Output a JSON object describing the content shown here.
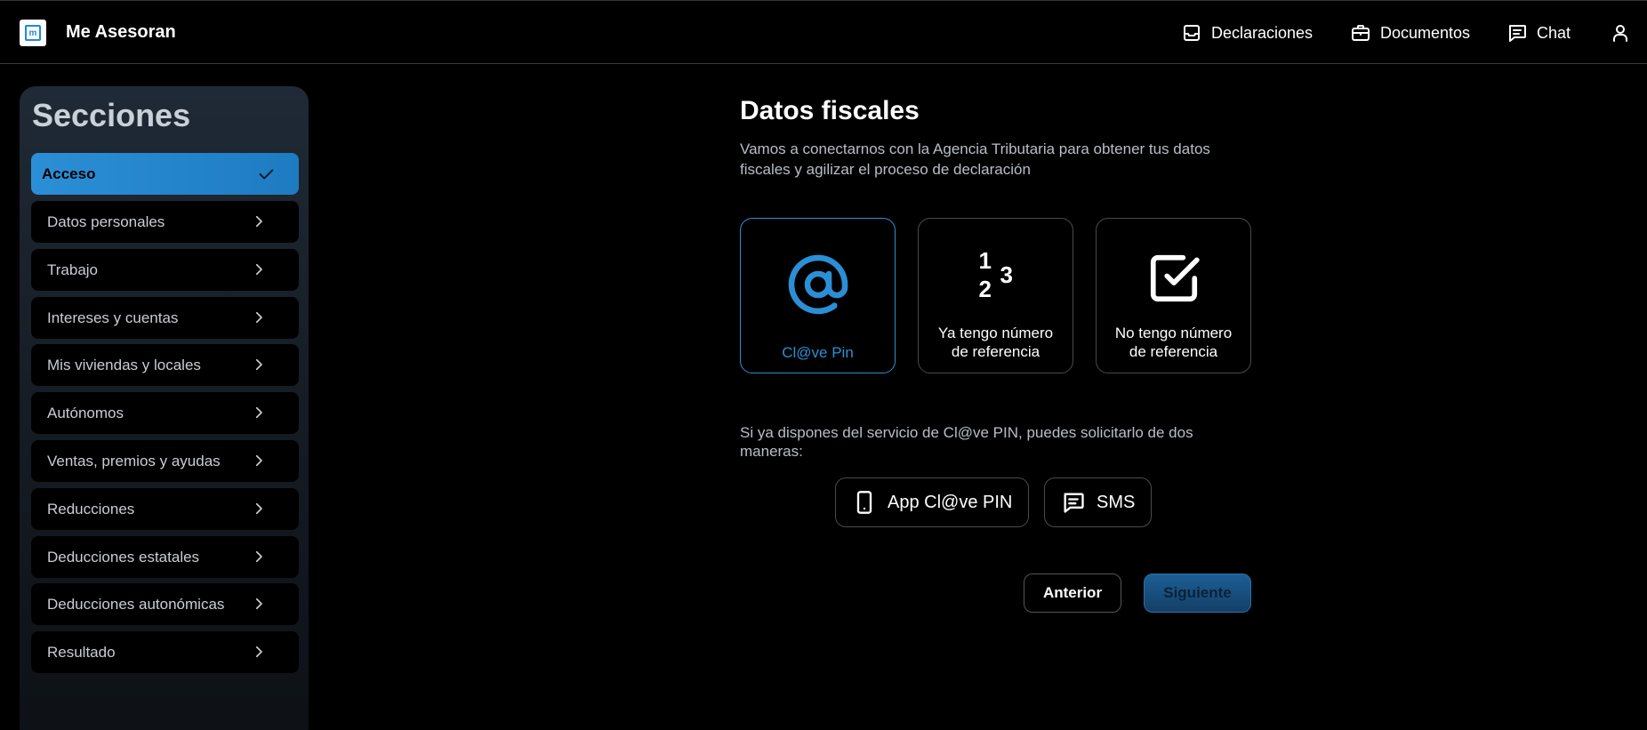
{
  "header": {
    "brand": "Me Asesoran",
    "logo_icon": "app-logo-icon",
    "nav": [
      {
        "label": "Declaraciones",
        "icon": "inbox-icon"
      },
      {
        "label": "Documentos",
        "icon": "briefcase-icon"
      },
      {
        "label": "Chat",
        "icon": "chat-icon"
      },
      {
        "label": "",
        "icon": "user-icon"
      }
    ]
  },
  "sidebar": {
    "title": "Secciones",
    "items": [
      {
        "label": "Acceso",
        "state": "completed"
      },
      {
        "label": "Datos personales"
      },
      {
        "label": "Trabajo"
      },
      {
        "label": "Intereses y cuentas"
      },
      {
        "label": "Mis viviendas y locales"
      },
      {
        "label": "Autónomos"
      },
      {
        "label": "Ventas, premios y ayudas"
      },
      {
        "label": "Reducciones"
      },
      {
        "label": "Deducciones estatales"
      },
      {
        "label": "Deducciones autonómicas"
      },
      {
        "label": "Resultado"
      }
    ]
  },
  "main": {
    "title": "Datos fiscales",
    "description": "Vamos a conectarnos con la Agencia Tributaria para obtener tus datos fiscales y agilizar el proceso de declaración",
    "options": [
      {
        "label": "Cl@ve Pin",
        "icon": "at-sign-icon",
        "selected": true
      },
      {
        "line1": "Ya tengo número",
        "line2": "de referencia",
        "icon": "numbers-123-icon",
        "icon_digits": [
          "1",
          "2",
          "3"
        ]
      },
      {
        "line1": "No tengo número",
        "line2": "de referencia",
        "icon": "checkbox-icon"
      }
    ],
    "info_text": "Si ya dispones del servicio de Cl@ve PIN, puedes solicitarlo de dos maneras:",
    "methods": [
      {
        "label": "App Cl@ve PIN",
        "icon": "smartphone-icon"
      },
      {
        "label": "SMS",
        "icon": "message-icon"
      }
    ],
    "prev_label": "Anterior",
    "next_label": "Siguiente"
  },
  "colors": {
    "accent": "#2b8fd6",
    "background": "#000000",
    "sidebar_bg": "#1f2a36",
    "muted_text": "#b8bec6",
    "next_button": "#1d5e95"
  }
}
